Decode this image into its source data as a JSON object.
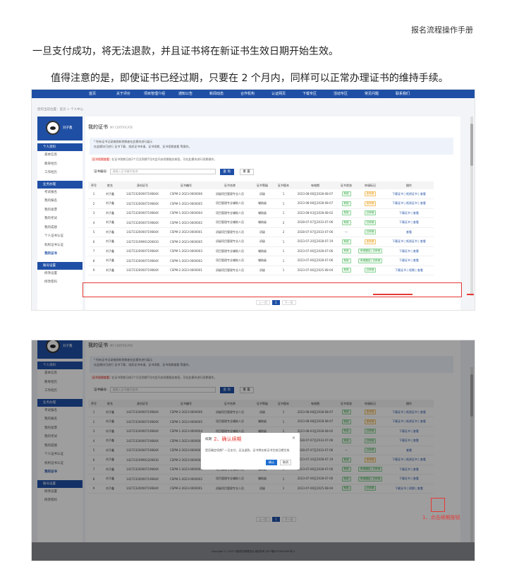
{
  "doc": {
    "header": "报名流程操作手册",
    "para1": "一旦支付成功，将无法退款，并且证书将在新证书生效日期开始生效。",
    "para2": "值得注意的是，即使证书已经过期，只要在 2 个月内，同样可以正常办理证书的维持手续。"
  },
  "nav": [
    "首页",
    "关于评价",
    "项目管理介绍",
    "通知公告",
    "新闻动态",
    "合作机构",
    "认证网页",
    "下载专区",
    "活动专区",
    "常见问题",
    "联系我们"
  ],
  "breadcrumb": "您的当前位置：首页 > 个人中心",
  "user": {
    "name": "刘子鑫"
  },
  "sidebar": {
    "sections": [
      {
        "title": "个人资料",
        "items": [
          "基本信息",
          "教育经历",
          "工作经历"
        ]
      },
      {
        "title": "业务办理",
        "items": [
          "考试报名",
          "我的报名",
          "我的发票",
          "我的考试",
          "我的成绩",
          "个人证书认证",
          "机构证书认证",
          "我的证书"
        ]
      },
      {
        "title": "账号设置",
        "items": [
          "修改设置",
          "修改密码"
        ]
      }
    ]
  },
  "page": {
    "title": "我的证书",
    "subtitle": "MY CERTIFICATE",
    "notice": [
      "* 所有证书记录按照新到期者在此模块进行展示",
      "在此模块可进行 证书下载、纸质证书申请、证书续期、证书续期查看 等操作。"
    ],
    "tip_tag": "证书续期查看",
    "tip_text": "在证书到期日前2个月及到期7月内会开启续期服务按钮，可在此模块进行续期操作。",
    "search_label": "证书编号:",
    "search_placeholder": "请输入证书编号查询",
    "query_btn": "查 询",
    "reset_btn": "重 置",
    "columns": [
      "序号",
      "姓名",
      "身份证号",
      "证书编号",
      "证书名称",
      "证书等级",
      "证书版本",
      "有效期",
      "证书状态",
      "申请标记",
      "操作"
    ],
    "rows": [
      [
        "1",
        "刘子鑫",
        "14272320000719084X",
        "CSPM-2-2023-0000006",
        "初级项目管理专业人员",
        "初级",
        "1",
        "2023-08-08至2028-08-07",
        "有效",
        "未申请",
        "下载证书 | 纸质证书 | 查看"
      ],
      [
        "2",
        "刘子鑫",
        "14272320000719084X",
        "CSPM-1-2023-0000005",
        "项目管理专业辅助人员",
        "辅助级",
        "1",
        "2023-08-08至2028-08-07",
        "有效",
        "未申请",
        "下载证书 | 纸质证书 | 查看"
      ],
      [
        "3",
        "刘子鑫",
        "14272320000719084X",
        "CSPM-1-2023-0000004",
        "项目管理专业辅助人员",
        "辅助级",
        "1",
        "2023-08-03至2028-08-02",
        "有效",
        "已申请",
        "下载证书 | 查看"
      ],
      [
        "4",
        "刘子鑫",
        "14272320000719084X",
        "CSPM-1-2023-0000002",
        "项目管理专业辅助人员",
        "辅助级",
        "2",
        "2028-07-07至2033-07-06",
        "有效",
        "已申请",
        "下载证书 | 查看"
      ],
      [
        "5",
        "刘子鑫",
        "14272320000719084X",
        "CSPM-2-2023-0000001",
        "初级项目管理专业人员",
        "初级",
        "2",
        "2028-07-07至2033-07-06",
        "—",
        "已申请",
        "查看"
      ],
      [
        "6",
        "刘子鑫",
        "142723199901200810",
        "CSPM-2-2023-0000005",
        "初级项目管理专业人员",
        "初级",
        "1",
        "2023-07-20至2028-07-19",
        "有效",
        "未申请",
        "下载证书 | 纸质证书 | 查看"
      ],
      [
        "7",
        "刘子鑫",
        "14272320000719084X",
        "CSPM-1-2023-0000003",
        "项目管理专业辅助人员",
        "辅助级",
        "1",
        "2023-07-06至2028-07-06",
        "有效",
        "申请退回 | 已申请",
        "下载证书 | 查看"
      ],
      [
        "8",
        "刘子鑫",
        "14272320000719084X",
        "CSPM-1-2023-0000002",
        "项目管理专业辅助人员",
        "辅助级",
        "1",
        "2023-07-06至2028-07-06",
        "有效",
        "申请退回 | 已申请",
        "下载证书 | 查看"
      ],
      [
        "9",
        "刘子鑫",
        "14272320000719084X",
        "CSPM-2-2023-0000001",
        "初级项目管理专业人员",
        "初级",
        "1",
        "2023-07-06至2025-08-04",
        "有效",
        "已申请",
        "下载证书 | 续期 | 查看"
      ]
    ],
    "pager": [
      "上一页",
      "1",
      "下一页"
    ]
  },
  "dialog": {
    "title": "续期",
    "step": "2、确认续期",
    "message": "是否确定续期? 一旦支付，无法退款，证书将在新证书生效日期生效",
    "ok": "确认",
    "cancel": "取消",
    "close": "×"
  },
  "annotation": {
    "step1": "1、点击续期按钮"
  },
  "footer": "Copyright © 2023 中国项目管理协会 版权所有 京ICP备2023000000号-1",
  "colors": {
    "nav": "#1f4fa5",
    "highlight": "#e53935"
  }
}
